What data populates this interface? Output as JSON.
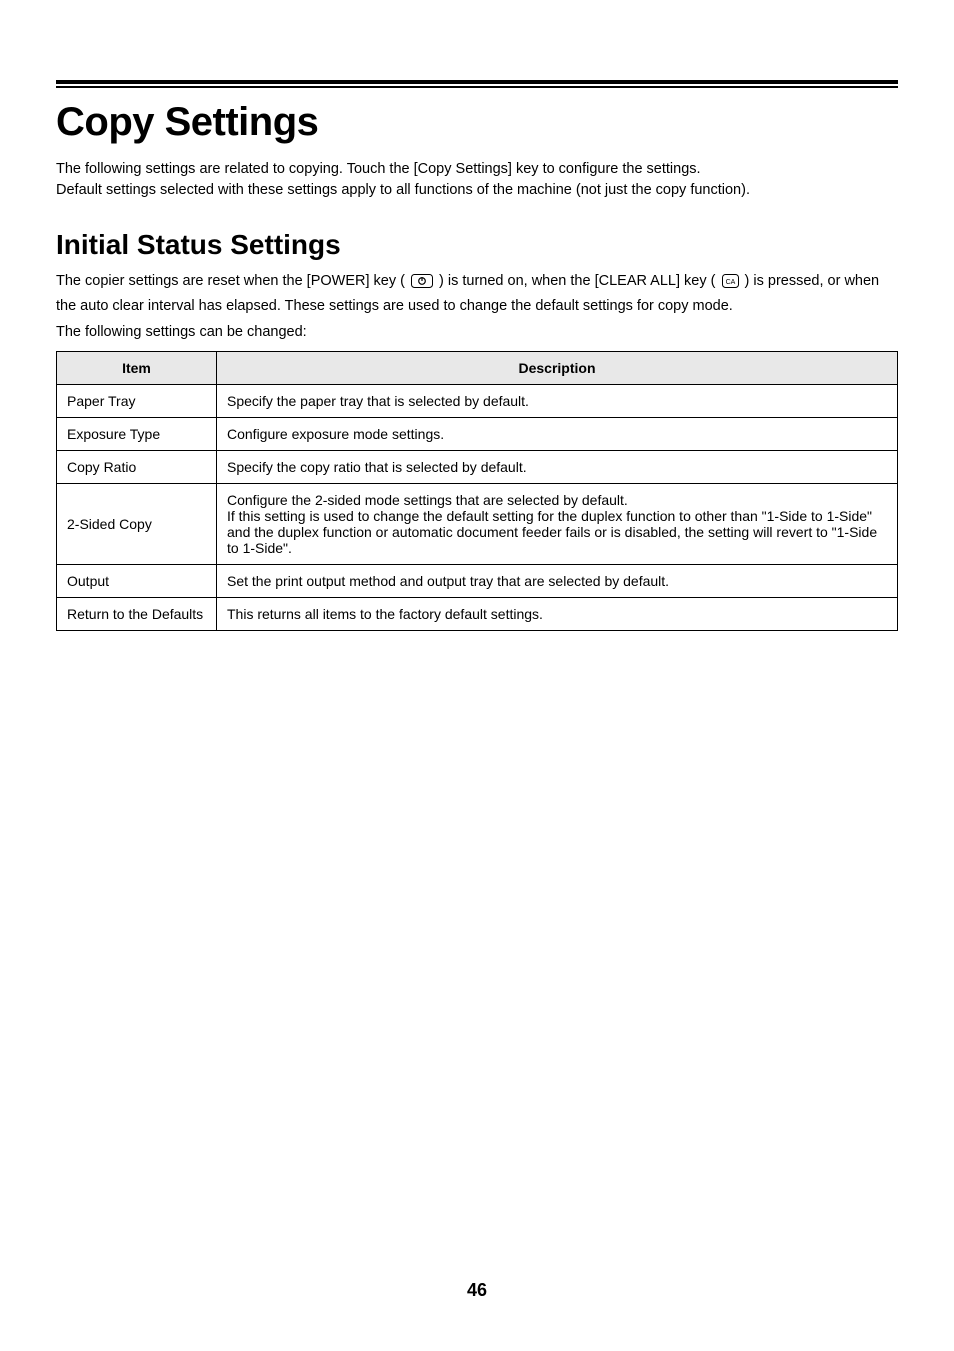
{
  "title": "Copy Settings",
  "intro": "The following settings are related to copying. Touch the [Copy Settings] key to configure the settings.\nDefault settings selected with these settings apply to all functions of the machine (not just the copy function).",
  "subtitle": "Initial Status Settings",
  "subintro_part1": "The copier settings are reset when the [POWER] key (",
  "subintro_part2": ") is turned on, when the [CLEAR ALL] key (",
  "subintro_part3": ") is pressed, or when the auto clear interval has elapsed. These settings are used to change the default settings for copy mode.",
  "subintro_line2": "The following settings can be changed:",
  "table": {
    "headers": {
      "item": "Item",
      "description": "Description"
    },
    "rows": [
      {
        "item": "Paper Tray",
        "description": "Specify the paper tray that is selected by default."
      },
      {
        "item": "Exposure Type",
        "description": "Configure exposure mode settings."
      },
      {
        "item": "Copy Ratio",
        "description": "Specify the copy ratio that is selected by default."
      },
      {
        "item": "2-Sided Copy",
        "description": "Configure the 2-sided mode settings that are selected by default.\nIf this setting is used to change the default setting for the duplex function to other than \"1-Side to 1-Side\" and the duplex function or automatic document feeder fails or is disabled, the setting will revert to \"1-Side to 1-Side\"."
      },
      {
        "item": "Output",
        "description": "Set the print output method and output tray that are selected by default."
      },
      {
        "item": "Return to the Defaults",
        "description": "This returns all items to the factory default settings."
      }
    ]
  },
  "page_number": "46"
}
